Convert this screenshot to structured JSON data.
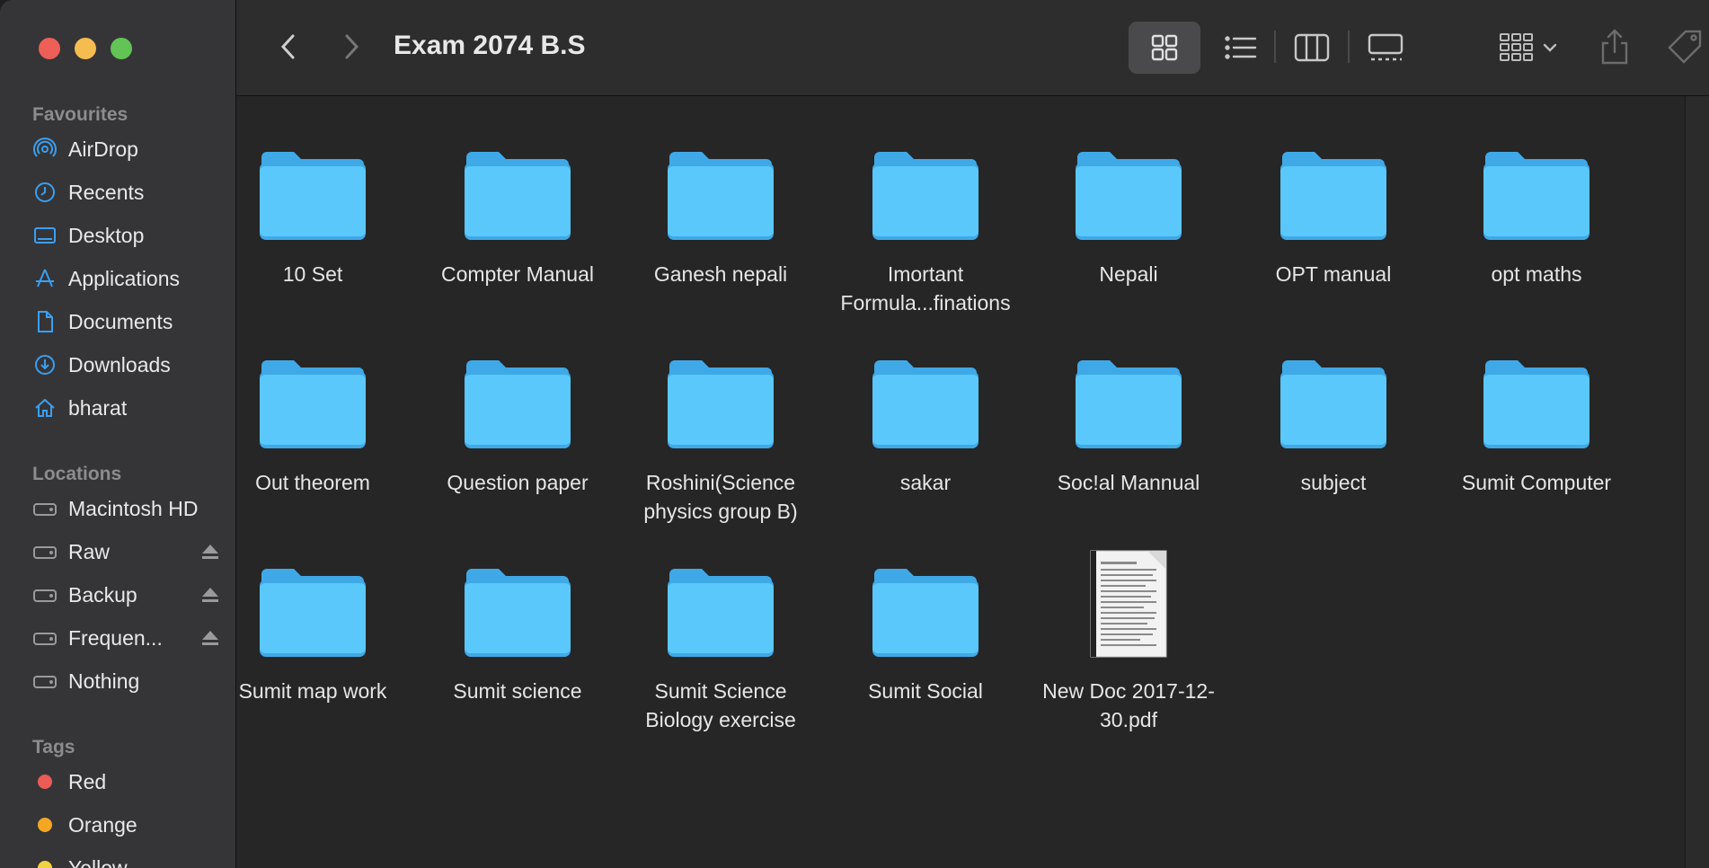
{
  "window": {
    "title": "Exam 2074 B.S"
  },
  "sidebar": {
    "favourites_title": "Favourites",
    "favourites": [
      {
        "label": "AirDrop",
        "icon": "airdrop-icon"
      },
      {
        "label": "Recents",
        "icon": "clock-icon"
      },
      {
        "label": "Desktop",
        "icon": "desktop-icon"
      },
      {
        "label": "Applications",
        "icon": "applications-icon"
      },
      {
        "label": "Documents",
        "icon": "document-icon"
      },
      {
        "label": "Downloads",
        "icon": "download-icon"
      },
      {
        "label": "bharat",
        "icon": "home-icon"
      }
    ],
    "locations_title": "Locations",
    "locations": [
      {
        "label": "Macintosh HD",
        "icon": "drive-icon",
        "ejectable": false
      },
      {
        "label": "Raw",
        "icon": "drive-icon",
        "ejectable": true
      },
      {
        "label": "Backup",
        "icon": "drive-icon",
        "ejectable": true
      },
      {
        "label": "Frequen...",
        "icon": "drive-icon",
        "ejectable": true
      },
      {
        "label": "Nothing",
        "icon": "drive-icon",
        "ejectable": false
      }
    ],
    "tags_title": "Tags",
    "tags": [
      {
        "label": "Red",
        "color": "#ec5b56"
      },
      {
        "label": "Orange",
        "color": "#f5a623"
      },
      {
        "label": "Yellow",
        "color": "#f2d33c"
      }
    ]
  },
  "colors": {
    "accent": "#3a9ff0",
    "folder_body": "#5ac8fa",
    "folder_back": "#3fa9e8",
    "close": "#ed5f57",
    "minimize": "#f5bd4f",
    "maximize": "#61c454"
  },
  "items": [
    {
      "label": "10 Set",
      "type": "folder"
    },
    {
      "label": "Compter Manual",
      "type": "folder"
    },
    {
      "label": "Ganesh nepali",
      "type": "folder"
    },
    {
      "label": "Imortant Formula...finations",
      "type": "folder"
    },
    {
      "label": "Nepali",
      "type": "folder"
    },
    {
      "label": "OPT manual",
      "type": "folder"
    },
    {
      "label": "opt maths",
      "type": "folder"
    },
    {
      "label": "Out theorem",
      "type": "folder"
    },
    {
      "label": "Question paper",
      "type": "folder"
    },
    {
      "label": "Roshini(Science physics group B)",
      "type": "folder"
    },
    {
      "label": "sakar",
      "type": "folder"
    },
    {
      "label": "Soc!al Mannual",
      "type": "folder"
    },
    {
      "label": "subject",
      "type": "folder"
    },
    {
      "label": "Sumit Computer",
      "type": "folder"
    },
    {
      "label": "Sumit map work",
      "type": "folder"
    },
    {
      "label": "Sumit science",
      "type": "folder"
    },
    {
      "label": "Sumit Science Biology exercise",
      "type": "folder"
    },
    {
      "label": "Sumit Social",
      "type": "folder"
    },
    {
      "label": "New Doc 2017-12-30.pdf",
      "type": "pdf"
    }
  ]
}
